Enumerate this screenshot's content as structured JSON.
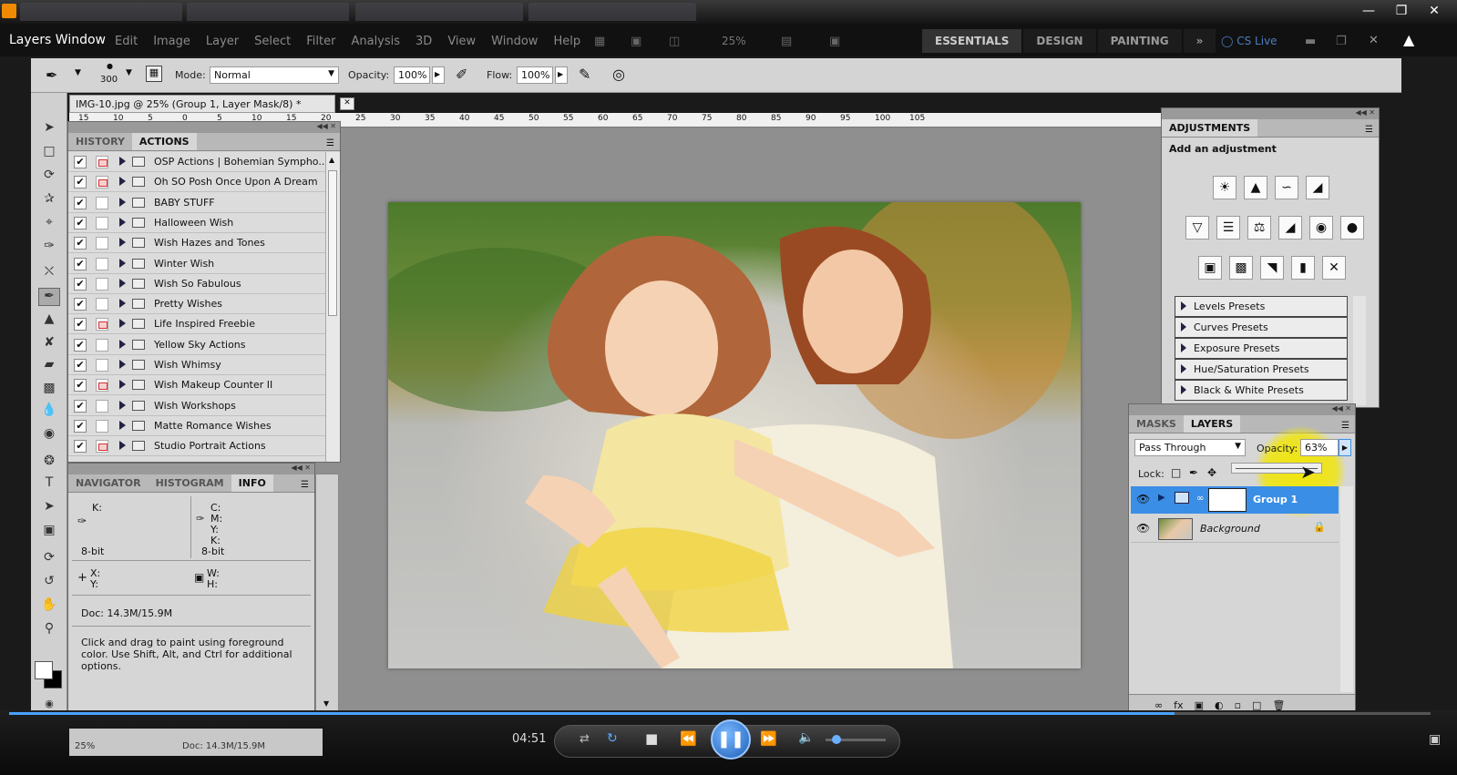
{
  "player": {
    "window_title": "Layers Window",
    "tabs": [
      "",
      "",
      "",
      "",
      ""
    ],
    "time": "04:51",
    "progress": 0.82,
    "volume": 0.1
  },
  "menu": [
    "Edit",
    "Image",
    "Layer",
    "Select",
    "Filter",
    "Analysis",
    "3D",
    "View",
    "Window",
    "Help"
  ],
  "zoom_menu": "25%",
  "workspaces": [
    "ESSENTIALS",
    "DESIGN",
    "PAINTING"
  ],
  "cs_live": "CS Live",
  "options": {
    "brush_size": "300",
    "mode_label": "Mode:",
    "mode": "Normal",
    "opacity_label": "Opacity:",
    "opacity": "100%",
    "flow_label": "Flow:",
    "flow": "100%"
  },
  "document": {
    "tab": "IMG-10.jpg @ 25% (Group 1, Layer Mask/8) *",
    "ruler": [
      "15",
      "10",
      "5",
      "0",
      "5",
      "10",
      "15",
      "20",
      "25",
      "30",
      "35",
      "40",
      "45",
      "50",
      "55",
      "60",
      "65",
      "70",
      "75",
      "80",
      "85",
      "90",
      "95",
      "100",
      "105"
    ]
  },
  "actions_panel": {
    "tabs": [
      "HISTORY",
      "ACTIONS"
    ],
    "items": [
      {
        "label": "OSP Actions | Bohemian Sympho...",
        "dialog": true
      },
      {
        "label": "Oh SO Posh Once Upon A Dream",
        "dialog": true
      },
      {
        "label": "BABY STUFF",
        "dialog": false
      },
      {
        "label": "Halloween Wish",
        "dialog": false
      },
      {
        "label": "Wish Hazes and Tones",
        "dialog": false
      },
      {
        "label": "Winter Wish",
        "dialog": false
      },
      {
        "label": "Wish So Fabulous",
        "dialog": false
      },
      {
        "label": "Pretty Wishes",
        "dialog": false
      },
      {
        "label": "Life Inspired Freebie",
        "dialog": true
      },
      {
        "label": "Yellow Sky Actions",
        "dialog": false
      },
      {
        "label": "Wish Whimsy",
        "dialog": false
      },
      {
        "label": "Wish Makeup Counter II",
        "dialog": true
      },
      {
        "label": "Wish Workshops",
        "dialog": false
      },
      {
        "label": "Matte Romance Wishes",
        "dialog": false
      },
      {
        "label": "Studio Portrait Actions",
        "dialog": true
      }
    ]
  },
  "info_panel": {
    "tabs": [
      "NAVIGATOR",
      "HISTOGRAM",
      "INFO"
    ],
    "k": "K:",
    "c": "C:",
    "m": "M:",
    "y": "Y:",
    "k2": "K:",
    "bit1": "8-bit",
    "bit2": "8-bit",
    "x": "X:",
    "y2": "Y:",
    "w": "W:",
    "h": "H:",
    "doc": "Doc: 14.3M/15.9M",
    "hint": "Click and drag to paint using foreground color. Use Shift, Alt, and Ctrl for additional options."
  },
  "status": {
    "zoom": "25%",
    "doc": "Doc: 14.3M/15.9M"
  },
  "adjustments": {
    "tab": "ADJUSTMENTS",
    "title": "Add an adjustment",
    "presets": [
      "Levels Presets",
      "Curves Presets",
      "Exposure Presets",
      "Hue/Saturation Presets",
      "Black & White Presets"
    ]
  },
  "layers": {
    "tabs": [
      "MASKS",
      "LAYERS"
    ],
    "blend": "Pass Through",
    "opacity_label": "Opacity:",
    "opacity": "63%",
    "lock": "Lock:",
    "items": [
      {
        "name": "Group 1",
        "selected": true
      },
      {
        "name": "Background",
        "selected": false
      }
    ]
  },
  "colors": {
    "accent": "#3a8ee6",
    "highlight": "#f2e600",
    "panel": "#d6d6d6"
  }
}
